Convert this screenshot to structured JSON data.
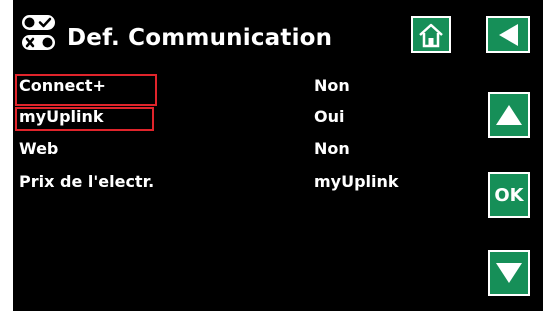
{
  "header": {
    "title": "Def. Communication",
    "icon": "toggle-switches-icon"
  },
  "nav": {
    "home_icon": "home-icon",
    "back_icon": "back-arrow-icon",
    "up_icon": "up-arrow-icon",
    "ok_label": "OK",
    "down_icon": "down-arrow-icon"
  },
  "settings": {
    "rows": [
      {
        "label": "Connect+",
        "value": "Non"
      },
      {
        "label": "myUplink",
        "value": "Oui"
      },
      {
        "label": "Web",
        "value": "Non"
      },
      {
        "label": "Prix de l'electr.",
        "value": "myUplink"
      }
    ]
  },
  "colors": {
    "background": "#000000",
    "button": "#168f58",
    "text": "#ffffff",
    "highlight": "#e0242b"
  }
}
